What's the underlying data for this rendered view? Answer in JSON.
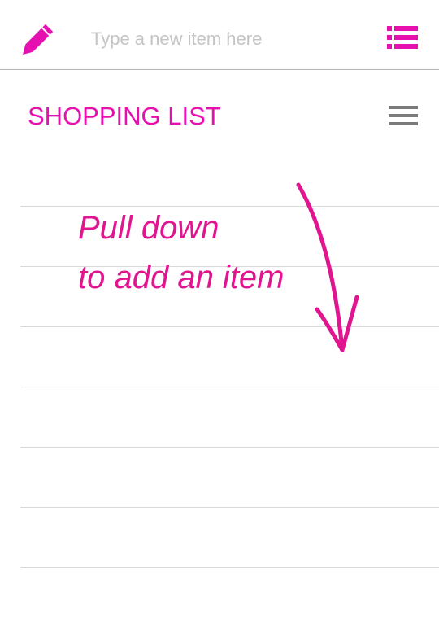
{
  "app": {
    "accent_color": "#e60fb0"
  },
  "top_bar": {
    "edit_icon": "pencil-icon",
    "new_item": {
      "value": "",
      "placeholder": "Type a new item here"
    },
    "lists_icon": "bulleted-list-icon"
  },
  "list": {
    "title": "SHOPPING LIST",
    "menu_icon": "hamburger-menu-icon",
    "items": []
  },
  "hint": {
    "line1": "Pull down",
    "line2": "to add an item",
    "color": "#e0158f",
    "arrow_icon": "hand-drawn-down-arrow"
  }
}
